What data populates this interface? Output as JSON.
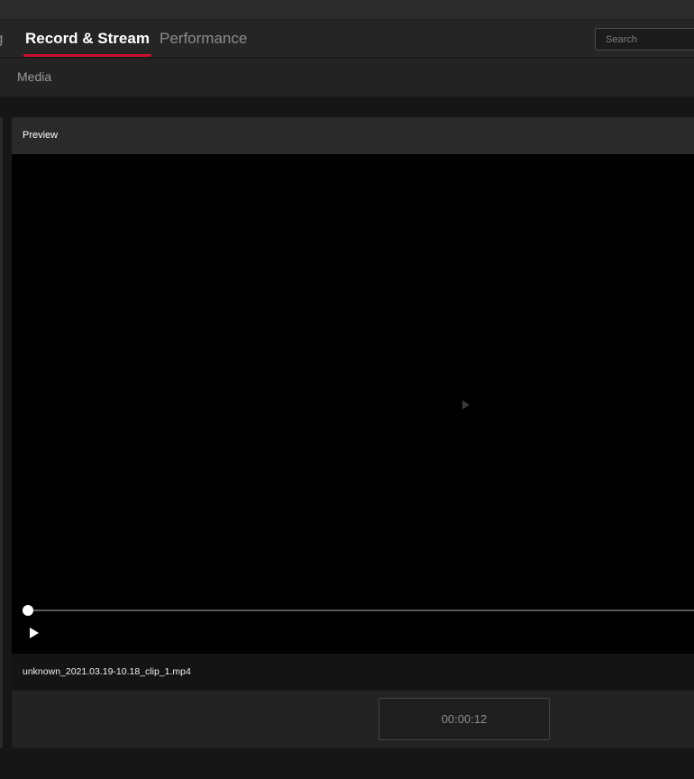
{
  "nav": {
    "tabs": [
      {
        "label": "g"
      },
      {
        "label": "Record & Stream"
      },
      {
        "label": "Performance"
      }
    ],
    "search_placeholder": "Search",
    "accent_color": "#c8102e"
  },
  "subnav": {
    "item": "Media"
  },
  "dialog": {
    "title": "Preview",
    "filename": "unknown_2021.03.19-10.18_clip_1.mp4",
    "timestamp": "00:00:12"
  },
  "icons": {
    "center_play": "play-icon",
    "play_button": "play-icon"
  },
  "player": {
    "progress": 0
  }
}
